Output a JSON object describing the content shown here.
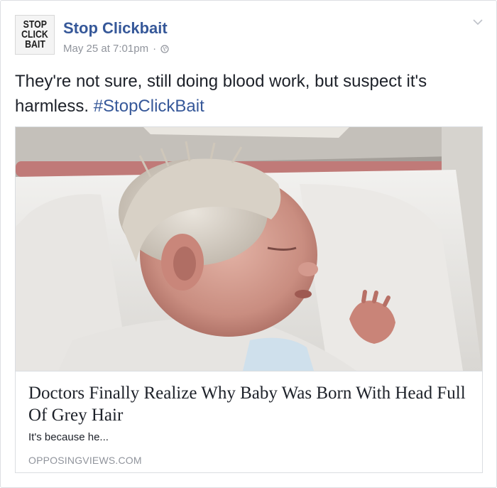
{
  "post": {
    "avatar_lines": [
      "STOP",
      "CLICK",
      "BAIT"
    ],
    "page_name": "Stop Clickbait",
    "timestamp": "May 25 at 7:01pm",
    "separator": "·",
    "audience_icon": "globe-icon",
    "menu_icon": "chevron-down-icon",
    "text": "They're not sure, still doing blood work, but suspect it's harmless.",
    "hashtag": "#StopClickBait"
  },
  "link_card": {
    "image_subject": "photo-newborn-baby-grey-hair",
    "title": "Doctors Finally Realize Why Baby Was Born With Head Full Of Grey Hair",
    "description": "It's because he...",
    "domain": "OPPOSINGVIEWS.COM"
  },
  "colors": {
    "link_blue": "#365899",
    "meta_gray": "#90949c",
    "text": "#1d2129",
    "border": "#dddfe2"
  }
}
